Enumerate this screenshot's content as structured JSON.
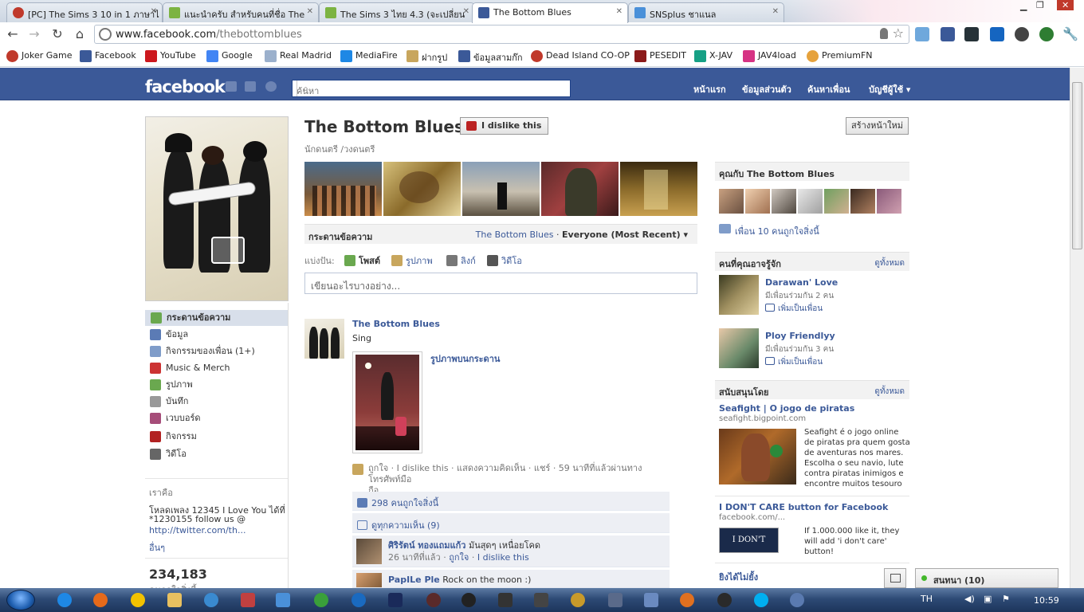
{
  "browser": {
    "tabs": [
      {
        "title": "[PC] The Sims 3 10 in 1 ภาษาไ",
        "color": "#c0392b",
        "active": false
      },
      {
        "title": "แนะนำครับ สำหรับคนที่ชื่อ The",
        "color": "#7cb342",
        "active": false
      },
      {
        "title": "The Sims 3 ไทย 4.3 (จะเปลี่ยน",
        "color": "#7cb342",
        "active": false
      },
      {
        "title": "The Bottom Blues",
        "color": "#3b5998",
        "active": true
      },
      {
        "title": "SNSplus ชาแนล",
        "color": "#4a90d9",
        "active": false
      }
    ],
    "url_host": "www.facebook.com",
    "url_path": "/thebottomblues",
    "bookmarks": [
      {
        "label": "Joker Game",
        "color": "#c0392b"
      },
      {
        "label": "Facebook",
        "color": "#3b5998"
      },
      {
        "label": "YouTube",
        "color": "#cc181e"
      },
      {
        "label": "Google",
        "color": "#4285f4"
      },
      {
        "label": "Real Madrid",
        "color": "#9bb0cc"
      },
      {
        "label": "MediaFire",
        "color": "#1e88e5"
      },
      {
        "label": "ฝากรูป",
        "color": "#c8a65d"
      },
      {
        "label": "ข้อมูลสามก๊ก",
        "color": "#3b5998"
      },
      {
        "label": "Dead Island CO-OP",
        "color": "#c0392b"
      },
      {
        "label": "PESEDIT",
        "color": "#8b1a1a"
      },
      {
        "label": "X-JAV",
        "color": "#16a085"
      },
      {
        "label": "JAV4load",
        "color": "#d63384"
      },
      {
        "label": "PremiumFN",
        "color": "#e6a23c"
      }
    ]
  },
  "fb": {
    "logo": "facebook",
    "search_placeholder": "ค้นหา",
    "nav": [
      "หน้าแรก",
      "ข้อมูลส่วนตัว",
      "ค้นหาเพื่อน",
      "บัญชีผู้ใช้ ▾"
    ]
  },
  "page": {
    "name": "The Bottom Blues",
    "dislike_label": "I dislike this",
    "category": "นักดนตรี /วงดนตรี",
    "create_page": "สร้างหน้าใหม่",
    "left_nav": [
      {
        "label": "กระดานข้อความ",
        "color": "#6aa84f"
      },
      {
        "label": "ข้อมูล",
        "color": "#5b7bb5"
      },
      {
        "label": "กิจกรรมของเพื่อน (1+)",
        "color": "#7f9cc9"
      },
      {
        "label": "Music & Merch",
        "color": "#cc3333"
      },
      {
        "label": "รูปภาพ",
        "color": "#6aa84f"
      },
      {
        "label": "บันทึก",
        "color": "#999999"
      },
      {
        "label": "เวบบอร์ด",
        "color": "#a64d79"
      },
      {
        "label": "กิจกรรม",
        "color": "#b22222"
      },
      {
        "label": "วิดีโอ",
        "color": "#666666"
      }
    ],
    "about_title": "เราคือ",
    "about_text_1": "โหลดเพลง 12345 I Love You ได้ที่",
    "about_text_2": "*1230155 follow us @",
    "about_link": "http://twitter.com/th...",
    "about_more": "อื่นๆ",
    "like_count": "234,183",
    "like_count_label": "คนถูกใจสิ่งนี้"
  },
  "wall": {
    "title": "กระดานข้อความ",
    "filter_page": "The Bottom Blues",
    "filter_sep": " · ",
    "filter_mode": "Everyone (Most Recent) ▾",
    "share_label": "แบ่งปัน:",
    "share_items": [
      {
        "label": "โพสต์",
        "color": "#6aa84f",
        "bold": true
      },
      {
        "label": "รูปภาพ",
        "color": "#c8a65d",
        "bold": false
      },
      {
        "label": "ลิงก์",
        "color": "#777777",
        "bold": false
      },
      {
        "label": "วิดีโอ",
        "color": "#555555",
        "bold": false
      }
    ],
    "composer_placeholder": "เขียนอะไรบางอย่าง...",
    "story": {
      "author": "The Bottom Blues",
      "message": "Sing",
      "attachment_title": "รูปภาพบนกระดาน",
      "meta_line1": "ถูกใจ · I dislike this · แสดงความคิดเห็น · แชร์ · 59 นาทีที่แล้วผ่านทางโทรศัพท์มือ",
      "meta_line2": "ถือ",
      "likes": "298 คนถูกใจสิ่งนี้",
      "view_comments": "ดูทุกความเห็น (9)",
      "comments": [
        {
          "name": "ศิริรัตน์ ทองแถมแก้ว",
          "text": " มันสุดๆ เหนื่อยโคด",
          "time": "26 นาทีที่แล้ว · ",
          "like": "ถูกใจ",
          "sep": " · ",
          "dislike": "I dislike this"
        },
        {
          "name": "PapILe Ple",
          "text": " Rock on the moon :)",
          "time": "",
          "like": "",
          "sep": "",
          "dislike": ""
        }
      ]
    }
  },
  "right": {
    "you_and": "คุณกับ The Bottom Blues",
    "friends_like": "เพื่อน 10 คนถูกใจสิ่งนี้",
    "pymk_title": "คนที่คุณอาจรู้จัก",
    "see_all": "ดูทั้งหมด",
    "people": [
      {
        "name": "Darawan' Love",
        "mutual": "มีเพื่อนร่วมกัน 2 คน",
        "add": "เพิ่มเป็นเพื่อน"
      },
      {
        "name": "Ploy Friendlyy",
        "mutual": "มีเพื่อนร่วมกัน 3 คน",
        "add": "เพิ่มเป็นเพื่อน"
      }
    ],
    "sponsored_title": "สนับสนุนโดย",
    "sponsored_all": "ดูทั้งหมด",
    "ads": [
      {
        "title": "Seafight | O jogo de piratas",
        "domain": "seafight.bigpoint.com",
        "body": [
          "Seafight é o jogo online",
          "de piratas pra quem gosta",
          "de aventuras nos mares.",
          "Escolha o seu navio, lute",
          "contra piratas inimigos e",
          "encontre muitos tesouro"
        ]
      },
      {
        "title": "I DON'T CARE button for Facebook",
        "domain": "facebook.com/...",
        "body": [
          "If 1.000.000 like it, they",
          "will add 'i don't care'",
          "button!"
        ],
        "image_text": "I DON'T CARE"
      }
    ],
    "third_ad_title": "ยิงได้ไม่ยั้ง"
  },
  "chat": {
    "label": "สนทนา (10)"
  },
  "taskbar": {
    "lang": "TH",
    "time": "10:59"
  }
}
